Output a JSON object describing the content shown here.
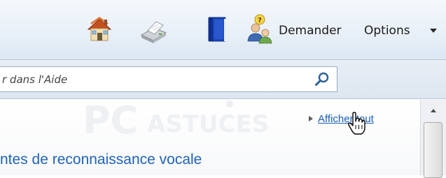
{
  "toolbar": {
    "home": {
      "icon": "home-icon"
    },
    "print": {
      "icon": "printer-icon"
    },
    "browse": {
      "icon": "book-icon"
    },
    "ask": {
      "icon": "people-question-icon",
      "label": "Demander"
    },
    "options": {
      "label": "Options",
      "icon": "chevron-down-icon"
    }
  },
  "search": {
    "placeholder": "r dans l'Aide",
    "icon": "search-icon"
  },
  "content": {
    "watermark_text": "PC ASTUCES",
    "show_all_label": "Afficher tout",
    "section_title": "ntes de reconnaissance vocale"
  },
  "colors": {
    "link": "#1a5fb4",
    "section_title": "#1f63b6",
    "toolbar_bg": "#e9f0f8"
  }
}
